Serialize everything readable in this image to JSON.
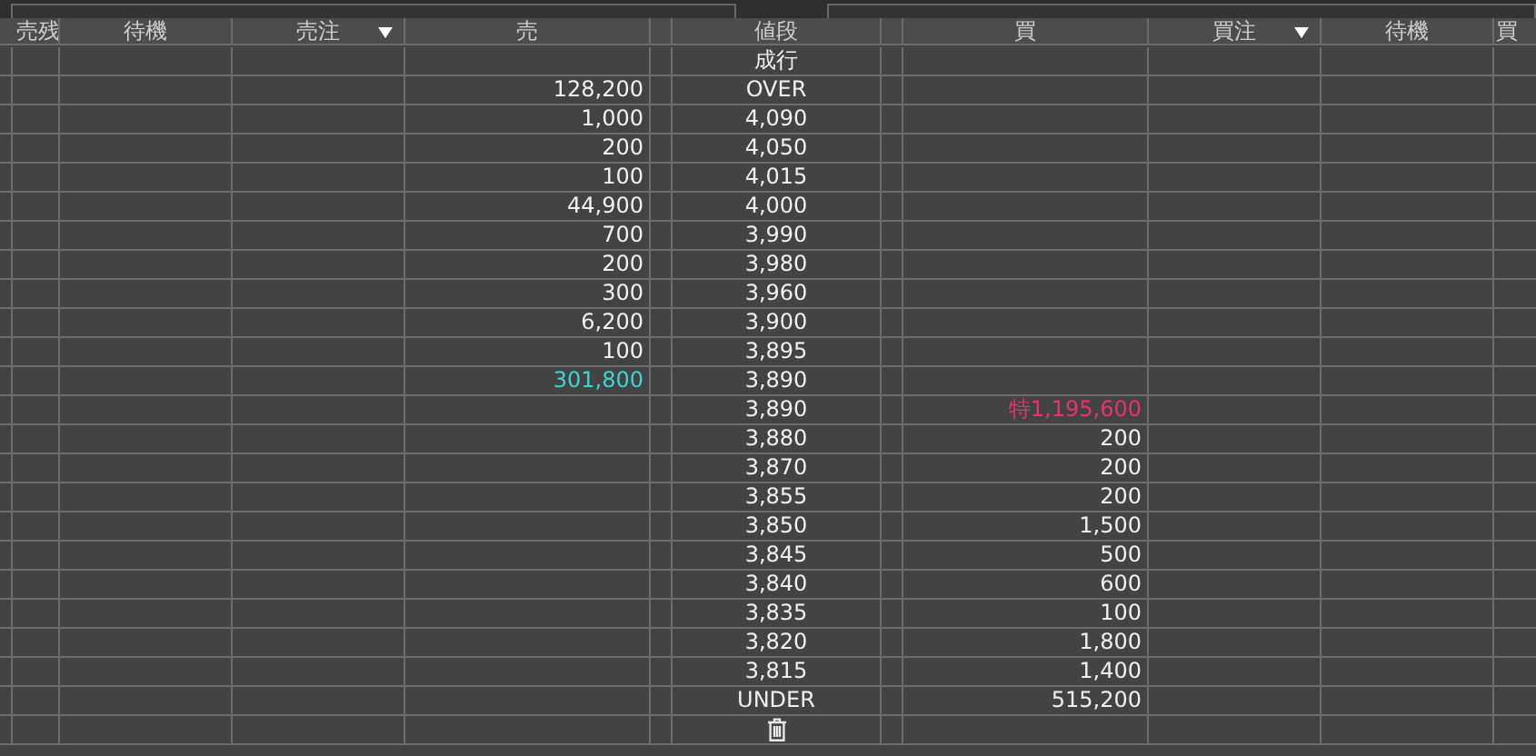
{
  "table": {
    "columns": [
      {
        "label": "売残",
        "sort": false
      },
      {
        "label": "待機",
        "sort": false
      },
      {
        "label": "売注",
        "sort": true
      },
      {
        "label": "売",
        "sort": false
      },
      {
        "label": "値段",
        "sort": false
      },
      {
        "label": "買",
        "sort": false
      },
      {
        "label": "買注",
        "sort": true
      },
      {
        "label": "待機",
        "sort": false
      },
      {
        "label": "買",
        "sort": false
      }
    ],
    "rows": [
      {
        "kind": "price",
        "sell": "",
        "price": "成行",
        "buy": ""
      },
      {
        "kind": "price",
        "sell": "128,200",
        "price": "OVER",
        "buy": ""
      },
      {
        "kind": "price",
        "sell": "1,000",
        "price": "4,090",
        "buy": ""
      },
      {
        "kind": "price",
        "sell": "200",
        "price": "4,050",
        "buy": ""
      },
      {
        "kind": "price",
        "sell": "100",
        "price": "4,015",
        "buy": ""
      },
      {
        "kind": "price",
        "sell": "44,900",
        "price": "4,000",
        "buy": ""
      },
      {
        "kind": "price",
        "sell": "700",
        "price": "3,990",
        "buy": ""
      },
      {
        "kind": "price",
        "sell": "200",
        "price": "3,980",
        "buy": ""
      },
      {
        "kind": "price",
        "sell": "300",
        "price": "3,960",
        "buy": ""
      },
      {
        "kind": "price",
        "sell": "6,200",
        "price": "3,900",
        "buy": ""
      },
      {
        "kind": "price",
        "sell": "100",
        "price": "3,895",
        "buy": ""
      },
      {
        "kind": "price",
        "sell": "301,800",
        "price": "3,890",
        "buy": "",
        "color": "#40d4d4"
      },
      {
        "kind": "price",
        "sell": "",
        "price": "3,890",
        "buy": "特1,195,600",
        "color": "#e8336e"
      },
      {
        "kind": "price",
        "sell": "",
        "price": "3,880",
        "buy": "200"
      },
      {
        "kind": "price",
        "sell": "",
        "price": "3,870",
        "buy": "200"
      },
      {
        "kind": "price",
        "sell": "",
        "price": "3,855",
        "buy": "200"
      },
      {
        "kind": "price",
        "sell": "",
        "price": "3,850",
        "buy": "1,500"
      },
      {
        "kind": "price",
        "sell": "",
        "price": "3,845",
        "buy": "500"
      },
      {
        "kind": "price",
        "sell": "",
        "price": "3,840",
        "buy": "600"
      },
      {
        "kind": "price",
        "sell": "",
        "price": "3,835",
        "buy": "100"
      },
      {
        "kind": "price",
        "sell": "",
        "price": "3,820",
        "buy": "1,800"
      },
      {
        "kind": "price",
        "sell": "",
        "price": "3,815",
        "buy": "1,400"
      },
      {
        "kind": "price",
        "sell": "",
        "price": "UNDER",
        "buy": "515,200"
      },
      {
        "kind": "trash"
      }
    ]
  }
}
